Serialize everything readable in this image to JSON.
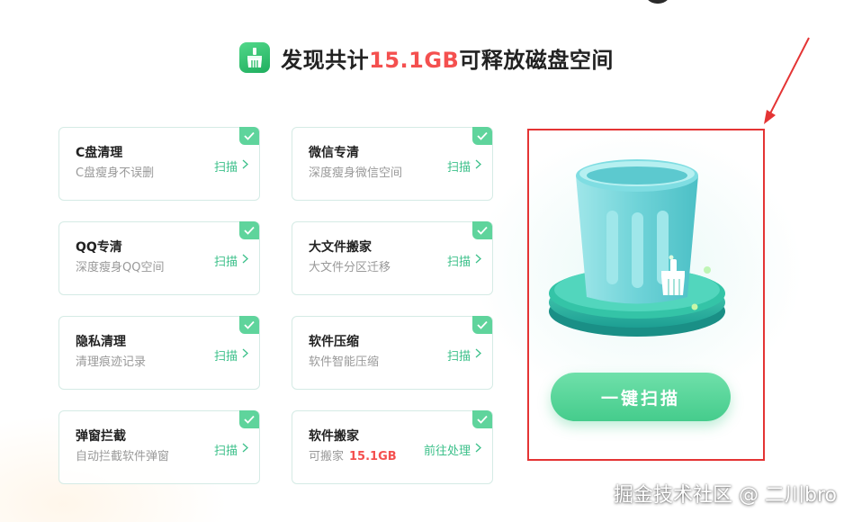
{
  "header": {
    "title_prefix": "发现共计",
    "title_size": "15.1GB",
    "title_suffix": "可释放磁盘空间",
    "logo_icon": "broom-icon"
  },
  "colors": {
    "accent": "#45cc8c",
    "highlight": "#f4504f",
    "annotation": "#e43434"
  },
  "cards": [
    {
      "title": "C盘清理",
      "desc": "C盘瘦身不误删",
      "action": "扫描",
      "checked": true
    },
    {
      "title": "微信专清",
      "desc": "深度瘦身微信空间",
      "action": "扫描",
      "checked": true
    },
    {
      "title": "QQ专清",
      "desc": "深度瘦身QQ空间",
      "action": "扫描",
      "checked": true
    },
    {
      "title": "大文件搬家",
      "desc": "大文件分区迁移",
      "action": "扫描",
      "checked": true
    },
    {
      "title": "隐私清理",
      "desc": "清理痕迹记录",
      "action": "扫描",
      "checked": true
    },
    {
      "title": "软件压缩",
      "desc": "软件智能压缩",
      "action": "扫描",
      "checked": true
    },
    {
      "title": "弹窗拦截",
      "desc": "自动拦截软件弹窗",
      "action": "扫描",
      "checked": true
    },
    {
      "title": "软件搬家",
      "desc": "可搬家",
      "desc_size": "15.1GB",
      "action": "前往处理",
      "checked": true
    }
  ],
  "hero": {
    "illustration_icon": "trash-can-cleaning-icon",
    "scan_button_label": "一键扫描"
  },
  "watermark": "掘金技术社区 @ 二川bro"
}
